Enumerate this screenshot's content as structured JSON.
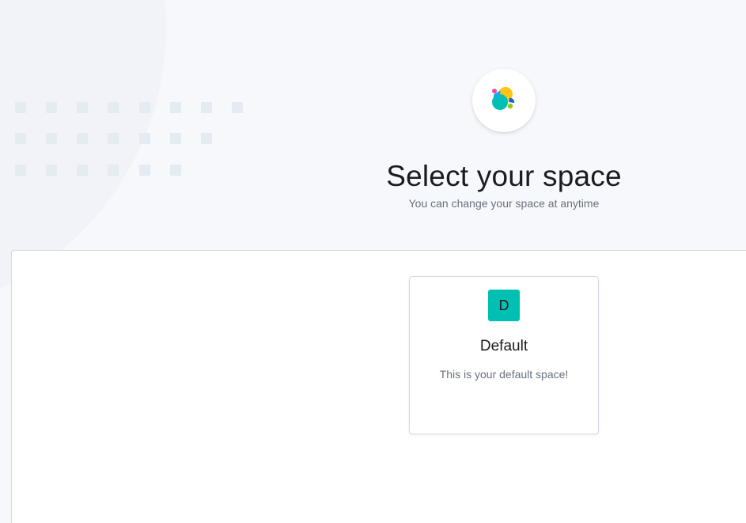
{
  "header": {
    "title": "Select your space",
    "subtitle": "You can change your space at anytime",
    "logo_icon": "elastic-logo-icon"
  },
  "spaces": [
    {
      "initial": "D",
      "name": "Default",
      "description": "This is your default space!",
      "avatar_color": "#00bfb3"
    }
  ],
  "colors": {
    "background": "#f7f8fc",
    "panel": "#ffffff",
    "border": "#d3dae6",
    "decorative_dot": "#e6eaf1"
  }
}
